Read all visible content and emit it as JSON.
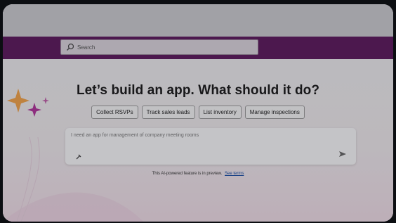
{
  "search": {
    "placeholder": "Search"
  },
  "main": {
    "headline": "Let’s build an app. What should it do?",
    "suggestions": [
      "Collect RSVPs",
      "Track sales leads",
      "List inventory",
      "Manage inspections"
    ],
    "prompt_text": "I need an app for management of company meeting rooms",
    "disclaimer": "This AI-powered feature is in preview.",
    "terms_link": "See terms"
  },
  "colors": {
    "app_bar": "#5d1a5d",
    "sparkle_orange": "#f0a24a",
    "sparkle_magenta": "#b0359a",
    "link": "#1b4fa5"
  },
  "icons": [
    "search-icon",
    "sparkle-icon",
    "attach-icon",
    "send-icon"
  ]
}
